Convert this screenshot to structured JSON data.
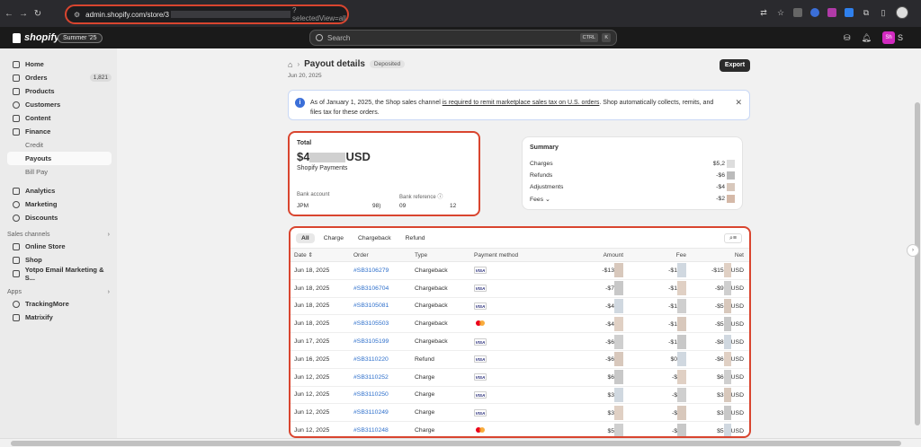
{
  "browser": {
    "url_prefix": "admin.shopify.com/store/3",
    "url_suffix": "?selectedView=all"
  },
  "topbar": {
    "brand": "shopify",
    "edition": "Summer '25",
    "search_placeholder": "Search",
    "shortcut_ctrl": "CTRL",
    "shortcut_key": "K",
    "store_initials": "Sh",
    "store_name_initial": "S"
  },
  "sidebar": {
    "home": "Home",
    "orders": "Orders",
    "orders_count": "1,821",
    "products": "Products",
    "customers": "Customers",
    "content": "Content",
    "finance": "Finance",
    "credit": "Credit",
    "payouts": "Payouts",
    "bill_pay": "Bill Pay",
    "analytics": "Analytics",
    "marketing": "Marketing",
    "discounts": "Discounts",
    "sales_channels": "Sales channels",
    "online_store": "Online Store",
    "shop": "Shop",
    "yotpo": "Yotpo Email Marketing & S...",
    "apps": "Apps",
    "trackingmore": "TrackingMore",
    "matrixify": "Matrixify"
  },
  "page": {
    "title": "Payout details",
    "status": "Deposited",
    "date": "Jun 20, 2025",
    "export": "Export"
  },
  "banner": {
    "text_before": "As of January 1, 2025, the Shop sales channel ",
    "link": "is required to remit marketplace sales tax on U.S. orders",
    "text_after": ". Shop automatically collects, remits, and files tax for these orders."
  },
  "total": {
    "label": "Total",
    "amount_prefix": "$4",
    "amount_suffix": "USD",
    "source": "Shopify Payments",
    "bank_account_label": "Bank account",
    "bank_reference_label": "Bank reference",
    "bank_account_start": "JPM",
    "bank_account_end": "98)",
    "bank_reference_start": "09",
    "bank_reference_end": "12"
  },
  "summary": {
    "title": "Summary",
    "rows": [
      {
        "label": "Charges",
        "value": "$5,2"
      },
      {
        "label": "Refunds",
        "value": "-$6"
      },
      {
        "label": "Adjustments",
        "value": "-$4"
      },
      {
        "label": "Fees",
        "value": "-$2"
      }
    ]
  },
  "tabs": [
    "All",
    "Charge",
    "Chargeback",
    "Refund"
  ],
  "table": {
    "headers": {
      "date": "Date",
      "order": "Order",
      "type": "Type",
      "payment": "Payment method",
      "amount": "Amount",
      "fee": "Fee",
      "net": "Net"
    },
    "rows": [
      {
        "date": "Jun 18, 2025",
        "order": "#SB3106279",
        "type": "Chargeback",
        "card": "VISA",
        "amount": "-$13",
        "fee": "-$1",
        "net": "-$15",
        "net_suffix": "USD"
      },
      {
        "date": "Jun 18, 2025",
        "order": "#SB3106704",
        "type": "Chargeback",
        "card": "VISA",
        "amount": "-$7",
        "fee": "-$1",
        "net": "-$9",
        "net_suffix": "USD"
      },
      {
        "date": "Jun 18, 2025",
        "order": "#SB3105081",
        "type": "Chargeback",
        "card": "VISA",
        "amount": "-$4",
        "fee": "-$1",
        "net": "-$5",
        "net_suffix": "USD"
      },
      {
        "date": "Jun 18, 2025",
        "order": "#SB3105503",
        "type": "Chargeback",
        "card": "MC",
        "amount": "-$4",
        "fee": "-$1",
        "net": "-$5",
        "net_suffix": "USD"
      },
      {
        "date": "Jun 17, 2025",
        "order": "#SB3105199",
        "type": "Chargeback",
        "card": "VISA",
        "amount": "-$6",
        "fee": "-$1",
        "net": "-$8",
        "net_suffix": "USD"
      },
      {
        "date": "Jun 16, 2025",
        "order": "#SB3110220",
        "type": "Refund",
        "card": "VISA",
        "amount": "-$6",
        "fee": "$0",
        "net": "-$6",
        "net_suffix": "USD"
      },
      {
        "date": "Jun 12, 2025",
        "order": "#SB3110252",
        "type": "Charge",
        "card": "VISA",
        "amount": "$6",
        "fee": "-$",
        "net": "$6",
        "net_suffix": "USD"
      },
      {
        "date": "Jun 12, 2025",
        "order": "#SB3110250",
        "type": "Charge",
        "card": "VISA",
        "amount": "$3",
        "fee": "-$",
        "net": "$3",
        "net_suffix": "USD"
      },
      {
        "date": "Jun 12, 2025",
        "order": "#SB3110249",
        "type": "Charge",
        "card": "VISA",
        "amount": "$3",
        "fee": "-$",
        "net": "$3",
        "net_suffix": "USD"
      },
      {
        "date": "Jun 12, 2025",
        "order": "#SB3110248",
        "type": "Charge",
        "card": "MC",
        "amount": "$5",
        "fee": "-$",
        "net": "$5",
        "net_suffix": "USD"
      }
    ]
  }
}
